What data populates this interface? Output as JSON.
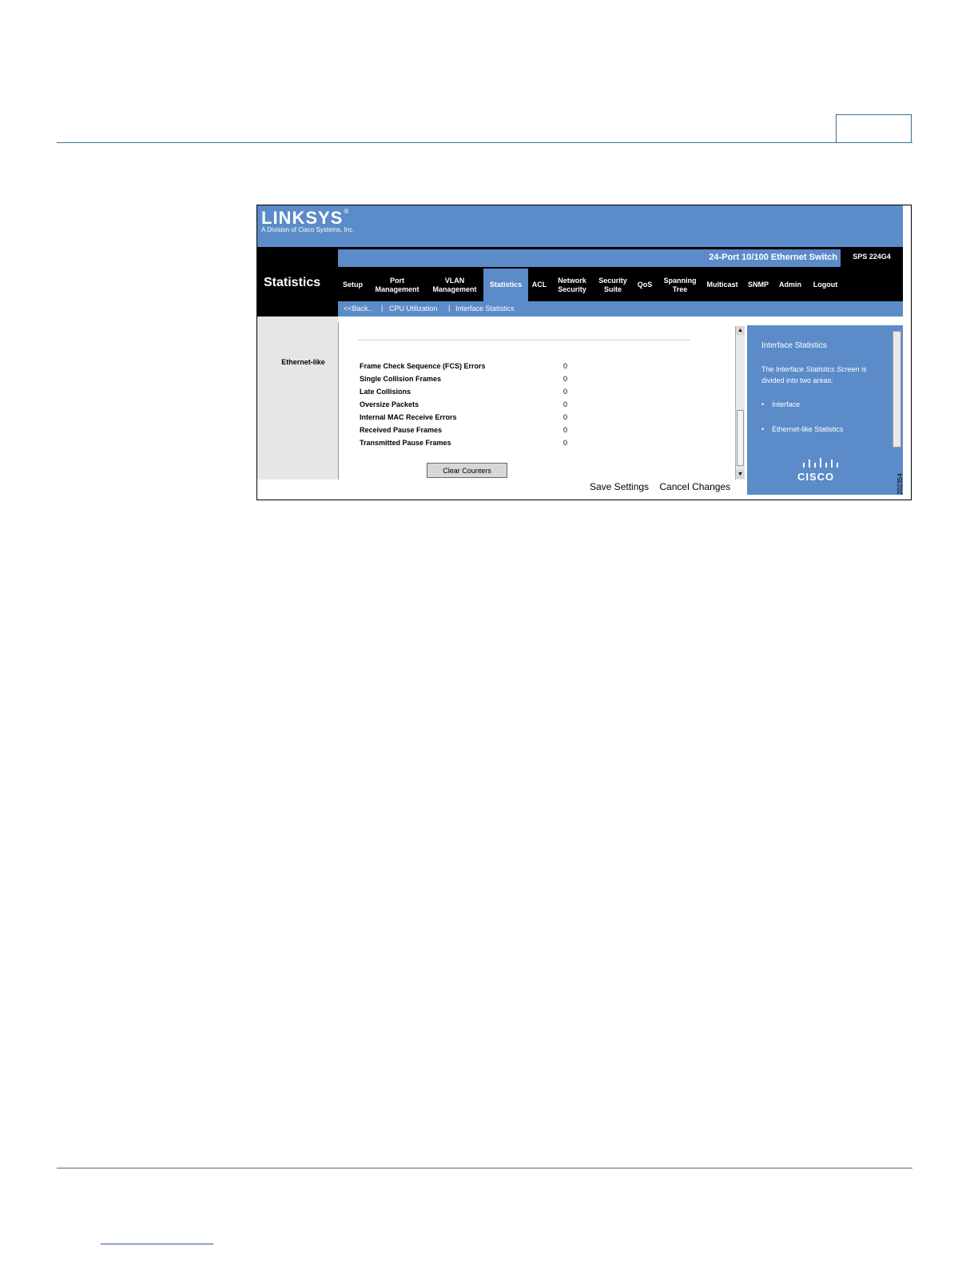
{
  "app": {
    "brand": "LINKSYS",
    "brand_mark": "®",
    "brand_sub": "A Division of Cisco Systems, Inc.",
    "product_name": "24-Port 10/100 Ethernet Switch",
    "model": "SPS 224G4",
    "section_title": "Statistics"
  },
  "nav": {
    "items": [
      {
        "label": "Setup",
        "active": false
      },
      {
        "label": "Port\nManagement",
        "active": false
      },
      {
        "label": "VLAN\nManagement",
        "active": false
      },
      {
        "label": "Statistics",
        "active": true
      },
      {
        "label": "ACL",
        "active": false
      },
      {
        "label": "Network\nSecurity",
        "active": false
      },
      {
        "label": "Security\nSuite",
        "active": false
      },
      {
        "label": "QoS",
        "active": false
      },
      {
        "label": "Spanning\nTree",
        "active": false
      },
      {
        "label": "Multicast",
        "active": false
      },
      {
        "label": "SNMP",
        "active": false
      },
      {
        "label": "Admin",
        "active": false
      },
      {
        "label": "Logout",
        "active": false
      }
    ]
  },
  "subnav": {
    "back": "<<Back..",
    "sep": "|",
    "cpu": "CPU Utilization",
    "interface": "Interface Statistics"
  },
  "side": {
    "section_label": "Ethernet-like"
  },
  "stats": {
    "rows": [
      {
        "label": "Frame Check Sequence (FCS) Errors",
        "value": "0"
      },
      {
        "label": "Single Collision Frames",
        "value": "0"
      },
      {
        "label": "Late Collisions",
        "value": "0"
      },
      {
        "label": "Oversize Packets",
        "value": "0"
      },
      {
        "label": "Internal MAC Receive Errors",
        "value": "0"
      },
      {
        "label": "Received Pause Frames",
        "value": "0"
      },
      {
        "label": "Transmitted Pause Frames",
        "value": "0"
      }
    ],
    "clear_button": "Clear Counters"
  },
  "footer_actions": {
    "save": "Save Settings",
    "cancel": "Cancel Changes"
  },
  "help": {
    "title": "Interface Statistics",
    "body_pre": "The ",
    "body_italic": "Interface Statistics Screen",
    "body_post": " is divided into two areas:",
    "bullets": [
      "Interface",
      "Ethernet-like Statistics"
    ],
    "cisco_word": "CISCO"
  },
  "figure_number": "202354",
  "colors": {
    "linksys_blue": "#5b8bc9",
    "nav_black": "#000000",
    "rule_blue": "#3d6f8f"
  },
  "icons": {
    "scroll_up": "▲",
    "scroll_down": "▼",
    "bullet": "•"
  }
}
